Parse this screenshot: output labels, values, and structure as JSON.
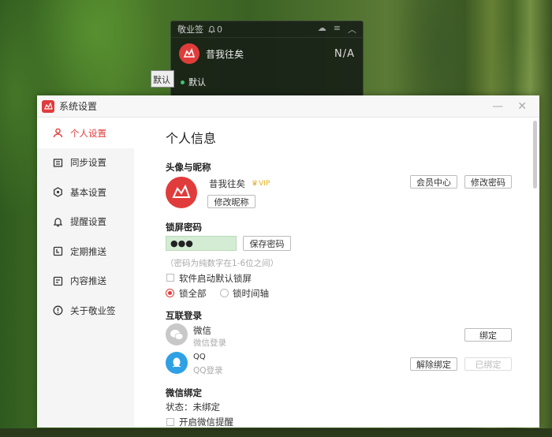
{
  "widget": {
    "title": "敬业签",
    "bell_count": "0",
    "user_name": "昔我往矣",
    "status": "N/A",
    "default_group": "默认"
  },
  "behind_tab": "默认",
  "dialog": {
    "title": "系统设置"
  },
  "sidebar": {
    "items": [
      {
        "label": "个人设置",
        "icon": "person-icon",
        "active": true
      },
      {
        "label": "同步设置",
        "icon": "sync-icon",
        "active": false
      },
      {
        "label": "基本设置",
        "icon": "settings-icon",
        "active": false
      },
      {
        "label": "提醒设置",
        "icon": "bell-icon",
        "active": false
      },
      {
        "label": "定期推送",
        "icon": "calendar-icon",
        "active": false
      },
      {
        "label": "内容推送",
        "icon": "document-icon",
        "active": false
      },
      {
        "label": "关于敬业签",
        "icon": "info-icon",
        "active": false
      }
    ]
  },
  "content": {
    "page_title": "个人信息",
    "avatar_section": {
      "heading": "头像与昵称",
      "nickname": "昔我往矣",
      "vip": "VIP",
      "edit_nickname": "修改昵称",
      "member_center": "会员中心",
      "change_password": "修改密码"
    },
    "lock_section": {
      "heading": "锁屏密码",
      "password_value": "●●●",
      "save_button": "保存密码",
      "hint": "（密码为纯数字在1-6位之间）",
      "checkbox_label": "软件启动默认锁屏",
      "radio_all": "锁全部",
      "radio_timeline": "锁时间轴",
      "selected_radio": "锁全部"
    },
    "login_section": {
      "heading": "互联登录",
      "wechat_name": "微信",
      "wechat_sub": "微信登录",
      "wechat_bind": "绑定",
      "qq_name": "QQ",
      "qq_sub": "QQ登录",
      "qq_unbind": "解除绑定",
      "qq_bound": "已绑定"
    },
    "wechat_bind_section": {
      "heading": "微信绑定",
      "status": "状态：未绑定",
      "checkbox_label": "开启微信提醒"
    }
  },
  "colors": {
    "accent": "#e03c3c",
    "sidebar_bg": "#f5f5f5",
    "password_field_bg": "#d4ecd4"
  }
}
